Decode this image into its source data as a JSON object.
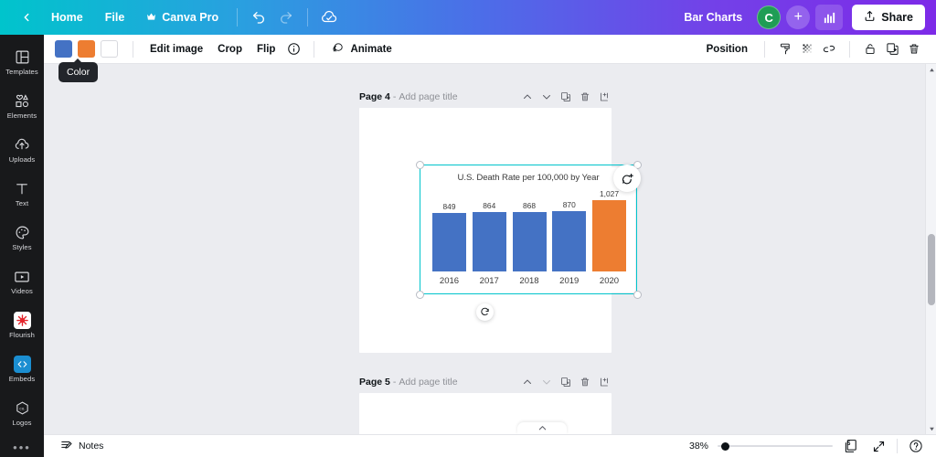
{
  "topbar": {
    "back_icon": "chevron-left-icon",
    "home_label": "Home",
    "file_label": "File",
    "pro_label": "Canva Pro",
    "pro_icon": "crown-icon",
    "undo_icon": "undo-icon",
    "redo_icon": "redo-icon",
    "cloud_icon": "cloud-check-icon",
    "doc_title": "Bar Charts",
    "avatar_initial": "C",
    "plus_label": "+",
    "chart_icon": "bar-chart-icon",
    "share_label": "Share",
    "share_icon": "share-upload-icon"
  },
  "sidebar": {
    "items": [
      {
        "label": "Templates",
        "icon": "templates-icon"
      },
      {
        "label": "Elements",
        "icon": "elements-icon"
      },
      {
        "label": "Uploads",
        "icon": "upload-cloud-icon"
      },
      {
        "label": "Text",
        "icon": "text-icon"
      },
      {
        "label": "Styles",
        "icon": "palette-icon"
      },
      {
        "label": "Videos",
        "icon": "video-icon"
      },
      {
        "label": "Flourish",
        "icon": "flourish-icon"
      },
      {
        "label": "Embeds",
        "icon": "embeds-icon"
      },
      {
        "label": "Logos",
        "icon": "logos-icon"
      }
    ],
    "more_label": "•••"
  },
  "toolbar": {
    "swatches": [
      {
        "name": "blue",
        "color": "#4472c4"
      },
      {
        "name": "orange",
        "color": "#ed7d31"
      },
      {
        "name": "white",
        "color": "#ffffff"
      }
    ],
    "edit_image_label": "Edit image",
    "crop_label": "Crop",
    "flip_label": "Flip",
    "info_icon": "info-icon",
    "animate_label": "Animate",
    "animate_icon": "animate-icon",
    "position_label": "Position",
    "paint_icon": "paint-roller-icon",
    "transparency_icon": "transparency-icon",
    "link_icon": "link-icon",
    "lock_icon": "lock-icon",
    "duplicate_icon": "duplicate-icon",
    "delete_icon": "trash-icon"
  },
  "tooltip": {
    "text": "Color"
  },
  "canvas": {
    "pages": [
      {
        "title_prefix": "Page 4",
        "separator": "-",
        "title_placeholder": "Add page title"
      },
      {
        "title_prefix": "Page 5",
        "separator": "-",
        "title_placeholder": "Add page title"
      }
    ],
    "page_actions": {
      "move_up_icon": "chevron-up-icon",
      "move_down_icon": "chevron-down-icon",
      "duplicate_icon": "duplicate-page-icon",
      "delete_icon": "trash-icon",
      "add_page_icon": "add-page-icon"
    },
    "rotate_icon": "rotate-handle-icon",
    "comment_icon": "add-comment-icon",
    "selection_color": "#00c4cc"
  },
  "chart_data": {
    "type": "bar",
    "title": "U.S. Death Rate per 100,000 by Year",
    "categories": [
      "2016",
      "2017",
      "2018",
      "2019",
      "2020"
    ],
    "values": [
      849,
      864,
      868,
      870,
      1027
    ],
    "value_labels": [
      "849",
      "864",
      "868",
      "870",
      "1,027"
    ],
    "colors": [
      "#4472c4",
      "#4472c4",
      "#4472c4",
      "#4472c4",
      "#ed7d31"
    ],
    "xlabel": "",
    "ylabel": "",
    "ylim": [
      0,
      1100
    ],
    "grid": false,
    "legend": false
  },
  "bottombar": {
    "notes_label": "Notes",
    "notes_icon": "notes-icon",
    "zoom_percent": "38%",
    "page_count": "5",
    "page_count_icon": "page-count-icon",
    "fullscreen_icon": "fullscreen-icon",
    "help_icon": "help-icon"
  },
  "scrollbar": {
    "up_icon": "scroll-up-icon",
    "down_icon": "scroll-down-icon"
  }
}
